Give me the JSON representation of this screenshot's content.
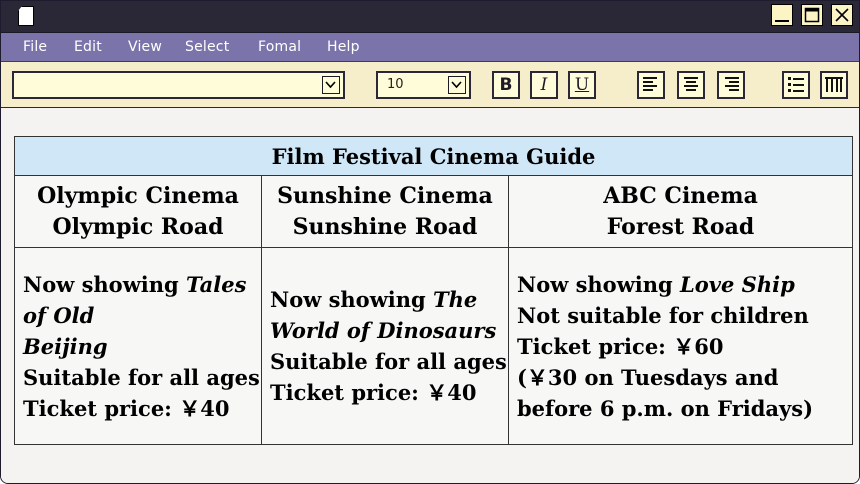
{
  "menu": {
    "file": "File",
    "edit": "Edit",
    "view": "View",
    "select": "Select",
    "format": "Fomal",
    "help": "Help"
  },
  "toolbar": {
    "font_value": "",
    "font_size": "10",
    "bold_label": "B",
    "italic_label": "I",
    "underline_label": "U"
  },
  "icons": {
    "app": "document-icon",
    "minimize": "minimize-icon",
    "maximize": "maximize-icon",
    "close": "close-icon",
    "align_left": "align-left-icon",
    "align_center": "align-center-icon",
    "align_right": "align-right-icon",
    "bullet_list": "bullet-list-icon",
    "columns": "columns-icon"
  },
  "colors": {
    "titlebar": "#2a2737",
    "menubar": "#7b74aa",
    "toolbar": "#f6eeca",
    "table_header": "#cfe7f7"
  },
  "document": {
    "table_title": "Film Festival Cinema Guide",
    "cinemas": [
      {
        "name": "Olympic Cinema",
        "address": "Olympic Road",
        "now_showing_prefix": "Now showing ",
        "film_line1": "Tales",
        "film_line2": "of Old",
        "film_line3": "Beijing",
        "suitability": "Suitable for all ages",
        "price_line": "Ticket price: ￥40"
      },
      {
        "name": "Sunshine Cinema",
        "address": "Sunshine Road",
        "now_showing_prefix": "Now showing ",
        "film_line1": "The",
        "film_line2": "World of Dinosaurs",
        "suitability": "Suitable for all ages",
        "price_line": "Ticket price: ￥40"
      },
      {
        "name": "ABC Cinema",
        "address": "Forest Road",
        "now_showing_prefix": "Now showing ",
        "film_line1": "Love Ship",
        "suitability": "Not suitable for children",
        "price_line": "Ticket price: ￥60",
        "discount_line1": "(￥30 on Tuesdays and",
        "discount_line2": "before 6 p.m. on Fridays)"
      }
    ]
  }
}
